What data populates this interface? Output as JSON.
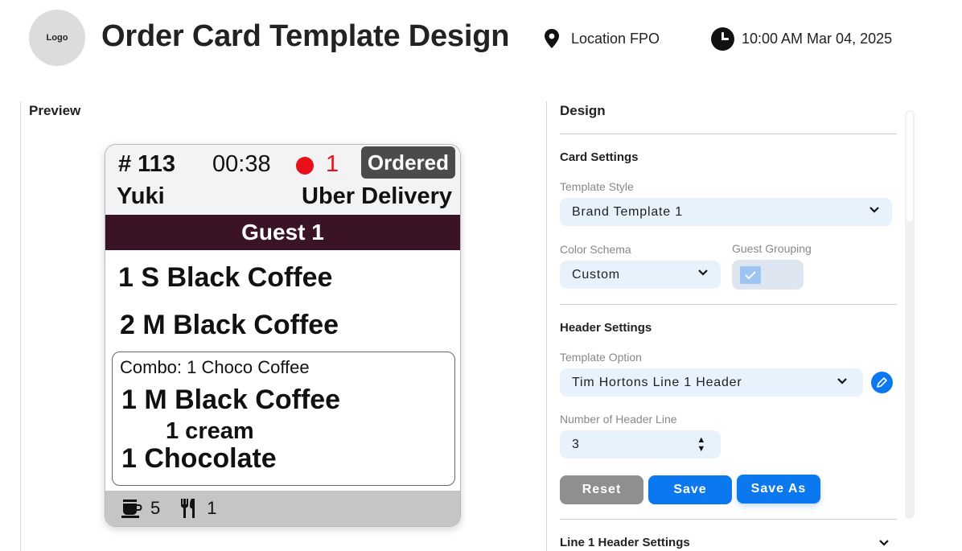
{
  "header": {
    "logo": "Logo",
    "title": "Order Card Template Design",
    "location": "Location FPO",
    "datetime": "10:00 AM Mar 04, 2025"
  },
  "preview": {
    "label": "Preview",
    "card": {
      "order_number": "# 113",
      "timer": "00:38",
      "alert_count": "1",
      "status": "Ordered",
      "customer": "Yuki",
      "channel": "Uber Delivery",
      "guest": "Guest 1",
      "items": [
        "1 S Black Coffee",
        "2 M Black Coffee"
      ],
      "combo": {
        "title": "Combo: 1 Choco Coffee",
        "item1": "1 M Black Coffee",
        "modifier": "1 cream",
        "item2": "1 Chocolate"
      },
      "footer": {
        "drinks": "5",
        "food": "1"
      }
    }
  },
  "design": {
    "label": "Design",
    "card_settings": {
      "title": "Card Settings",
      "template_style_label": "Template Style",
      "template_style_value": "Brand Template 1",
      "color_schema_label": "Color Schema",
      "color_schema_value": "Custom",
      "guest_grouping_label": "Guest Grouping"
    },
    "header_settings": {
      "title": "Header Settings",
      "template_option_label": "Template Option",
      "template_option_value": "Tim Hortons Line 1 Header",
      "header_lines_label": "Number of Header Line",
      "header_lines_value": "3"
    },
    "buttons": {
      "reset": "Reset",
      "save": "Save",
      "save_as": "Save As"
    },
    "line1_header_settings": "Line 1 Header Settings"
  },
  "colors": {
    "accent": "#0b78f0",
    "guest_bar": "#3a1426",
    "alert": "#e8101a",
    "field_bg": "#e8f2fd"
  }
}
